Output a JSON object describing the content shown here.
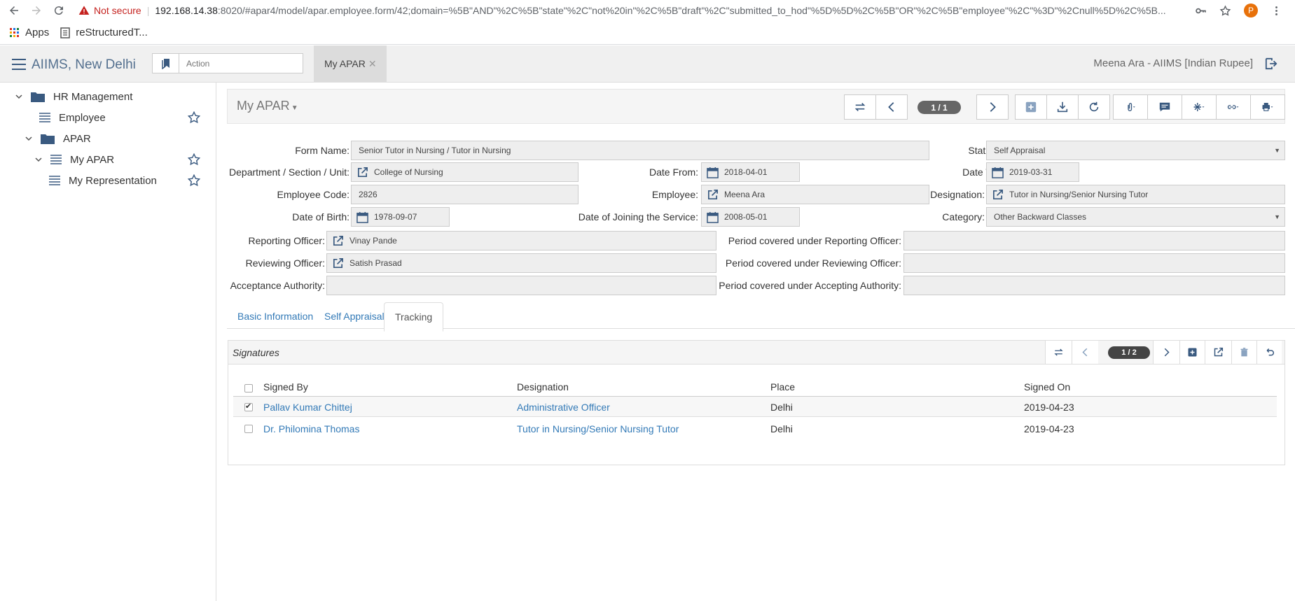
{
  "browser": {
    "not_secure": "Not secure",
    "url_host": "192.168.14.38",
    "url_rest": ":8020/#apar4/model/apar.employee.form/42;domain=%5B\"AND\"%2C%5B\"state\"%2C\"not%20in\"%2C%5B\"draft\"%2C\"submitted_to_hod\"%5D%5D%2C%5B\"OR\"%2C%5B\"employee\"%2C\"%3D\"%2Cnull%5D%2C%5B...",
    "profile_initial": "P",
    "bookmarks": [
      "Apps",
      "reStructuredT..."
    ]
  },
  "app": {
    "brand": "AIIMS, New Delhi",
    "action_placeholder": "Action",
    "open_tab": "My APAR",
    "user": "Meena Ara - AIIMS [Indian Rupee]"
  },
  "sidebar": {
    "items": [
      {
        "label": "HR Management"
      },
      {
        "label": "Employee"
      },
      {
        "label": "APAR"
      },
      {
        "label": "My APAR"
      },
      {
        "label": "My Representation"
      }
    ]
  },
  "toolbar": {
    "title": "My APAR",
    "pager": "1 / 1"
  },
  "form": {
    "form_name_label": "Form Name:",
    "form_name": "Senior Tutor in Nursing / Tutor in Nursing",
    "status_label": "Status:",
    "status": "Self Appraisal",
    "department_label": "Department / Section / Unit:",
    "department": "College of Nursing",
    "date_from_label": "Date From:",
    "date_from": "2018-04-01",
    "date_to_label": "Date To:",
    "date_to": "2019-03-31",
    "employee_code_label": "Employee Code:",
    "employee_code": "2826",
    "employee_label": "Employee:",
    "employee": "Meena Ara",
    "designation_label": "Designation:",
    "designation": "Tutor in Nursing/Senior Nursing Tutor",
    "dob_label": "Date of Birth:",
    "dob": "1978-09-07",
    "doj_label": "Date of Joining the Service:",
    "doj": "2008-05-01",
    "category_label": "Category:",
    "category": "Other Backward Classes",
    "reporting_label": "Reporting Officer:",
    "reporting": "Vinay Pande",
    "period_reporting_label": "Period covered under Reporting Officer:",
    "period_reporting": "",
    "reviewing_label": "Reviewing Officer:",
    "reviewing": "Satish Prasad",
    "period_reviewing_label": "Period covered under Reviewing Officer:",
    "period_reviewing": "",
    "acceptance_label": "Acceptance Authority:",
    "acceptance": "",
    "period_accepting_label": "Period covered under Accepting Authority:",
    "period_accepting": ""
  },
  "tabs": [
    "Basic Information",
    "Self Appraisal",
    "Tracking"
  ],
  "signatures": {
    "title": "Signatures",
    "pager": "1 / 2",
    "columns": [
      "Signed By",
      "Designation",
      "Place",
      "Signed On"
    ],
    "rows": [
      {
        "signed_by": "Pallav Kumar Chittej",
        "designation": "Administrative Officer",
        "place": "Delhi",
        "signed_on": "2019-04-23",
        "checked": true
      },
      {
        "signed_by": "Dr. Philomina Thomas",
        "designation": "Tutor in Nursing/Senior Nursing Tutor",
        "place": "Delhi",
        "signed_on": "2019-04-23",
        "checked": false
      }
    ]
  }
}
